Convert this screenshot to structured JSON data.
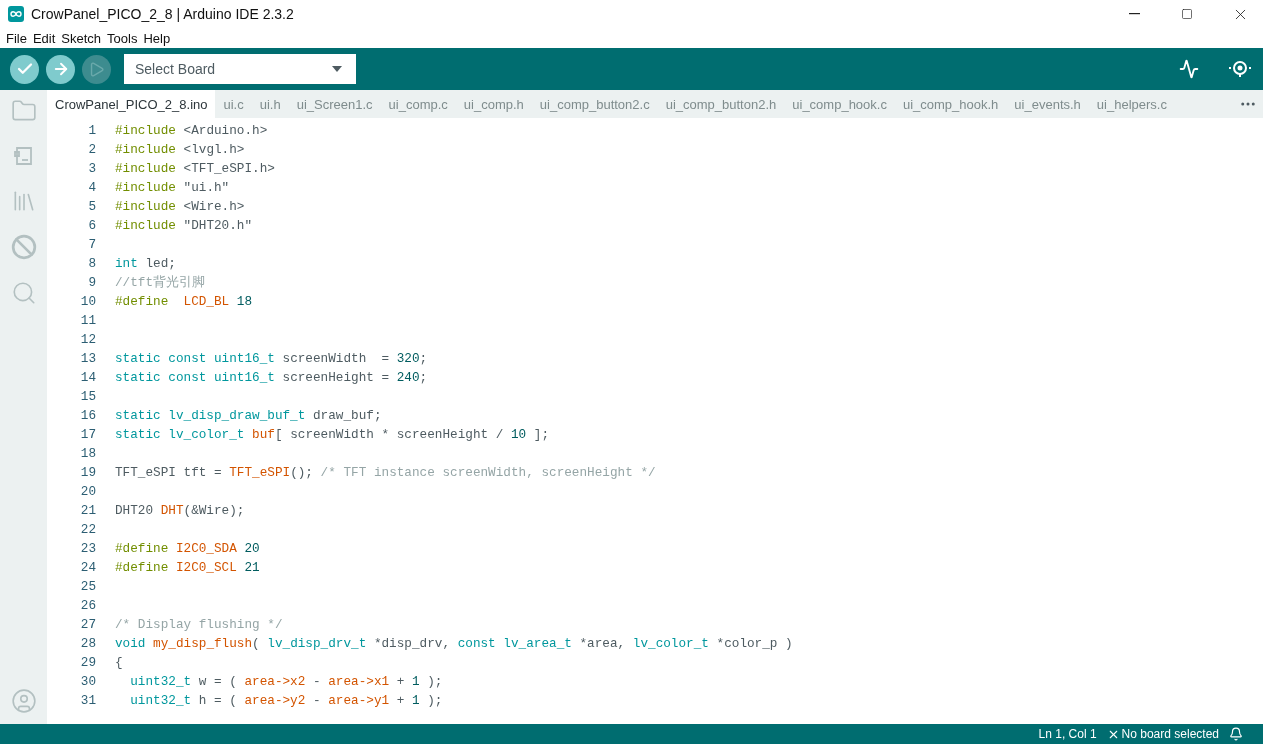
{
  "window": {
    "title": "CrowPanel_PICO_2_8 | Arduino IDE 2.3.2"
  },
  "menu": [
    "File",
    "Edit",
    "Sketch",
    "Tools",
    "Help"
  ],
  "toolbar": {
    "buttons": [
      {
        "kind": "verify",
        "disabled": false
      },
      {
        "kind": "upload",
        "disabled": false
      },
      {
        "kind": "debug",
        "disabled": true
      }
    ],
    "board_select": {
      "value": "Select Board"
    }
  },
  "tabs": [
    {
      "label": "CrowPanel_PICO_2_8.ino",
      "selected": true
    },
    {
      "label": "ui.c",
      "selected": false
    },
    {
      "label": "ui.h",
      "selected": false
    },
    {
      "label": "ui_Screen1.c",
      "selected": false
    },
    {
      "label": "ui_comp.c",
      "selected": false
    },
    {
      "label": "ui_comp.h",
      "selected": false
    },
    {
      "label": "ui_comp_button2.c",
      "selected": false
    },
    {
      "label": "ui_comp_button2.h",
      "selected": false
    },
    {
      "label": "ui_comp_hook.c",
      "selected": false
    },
    {
      "label": "ui_comp_hook.h",
      "selected": false
    },
    {
      "label": "ui_events.h",
      "selected": false
    },
    {
      "label": "ui_helpers.c",
      "selected": false
    }
  ],
  "sidebar": {
    "items": [
      {
        "kind": "folder"
      },
      {
        "kind": "boards"
      },
      {
        "kind": "library"
      },
      {
        "kind": "debug"
      },
      {
        "kind": "search"
      }
    ],
    "bottom": [
      {
        "kind": "account"
      }
    ]
  },
  "editor": {
    "lines": [
      {
        "number": "1",
        "tokens": [
          {
            "kind": "pre",
            "text": "#include"
          },
          {
            "kind": "plain",
            "text": " <Arduino.h>"
          }
        ]
      },
      {
        "number": "2",
        "tokens": [
          {
            "kind": "pre",
            "text": "#include"
          },
          {
            "kind": "plain",
            "text": " <lvgl.h>"
          }
        ]
      },
      {
        "number": "3",
        "tokens": [
          {
            "kind": "pre",
            "text": "#include"
          },
          {
            "kind": "plain",
            "text": " <TFT_eSPI.h>"
          }
        ]
      },
      {
        "number": "4",
        "tokens": [
          {
            "kind": "pre",
            "text": "#include"
          },
          {
            "kind": "plain",
            "text": " \"ui.h\""
          }
        ]
      },
      {
        "number": "5",
        "tokens": [
          {
            "kind": "pre",
            "text": "#include"
          },
          {
            "kind": "plain",
            "text": " <Wire.h>"
          }
        ]
      },
      {
        "number": "6",
        "tokens": [
          {
            "kind": "pre",
            "text": "#include"
          },
          {
            "kind": "plain",
            "text": " \"DHT20.h\""
          }
        ]
      },
      {
        "number": "7"
      },
      {
        "number": "8",
        "tokens": [
          {
            "kind": "type",
            "text": "int"
          },
          {
            "kind": "plain",
            "text": " led;"
          }
        ]
      },
      {
        "number": "9",
        "tokens": [
          {
            "kind": "comment",
            "text": "//tft背光引脚"
          }
        ]
      },
      {
        "number": "10",
        "tokens": [
          {
            "kind": "pre",
            "text": "#define"
          },
          {
            "kind": "fn",
            "text": "  LCD_BL"
          },
          {
            "kind": "num",
            "text": " 18"
          }
        ]
      },
      {
        "number": "11"
      },
      {
        "number": "12"
      },
      {
        "number": "13",
        "tokens": [
          {
            "kind": "type",
            "text": "static"
          },
          {
            "kind": "type",
            "text": " const"
          },
          {
            "kind": "type",
            "text": " uint16_t"
          },
          {
            "kind": "plain",
            "text": " screenWidth  = "
          },
          {
            "kind": "num",
            "text": "320"
          },
          {
            "kind": "plain",
            "text": ";"
          }
        ]
      },
      {
        "number": "14",
        "tokens": [
          {
            "kind": "type",
            "text": "static"
          },
          {
            "kind": "type",
            "text": " const"
          },
          {
            "kind": "type",
            "text": " uint16_t"
          },
          {
            "kind": "plain",
            "text": " screenHeight = "
          },
          {
            "kind": "num",
            "text": "240"
          },
          {
            "kind": "plain",
            "text": ";"
          }
        ]
      },
      {
        "number": "15"
      },
      {
        "number": "16",
        "tokens": [
          {
            "kind": "type",
            "text": "static"
          },
          {
            "kind": "type",
            "text": " lv_disp_draw_buf_t"
          },
          {
            "kind": "plain",
            "text": " draw_buf;"
          }
        ]
      },
      {
        "number": "17",
        "tokens": [
          {
            "kind": "type",
            "text": "static"
          },
          {
            "kind": "type",
            "text": " lv_color_t"
          },
          {
            "kind": "fn",
            "text": " buf"
          },
          {
            "kind": "plain",
            "text": "[ screenWidth * screenHeight / "
          },
          {
            "kind": "num",
            "text": "10"
          },
          {
            "kind": "plain",
            "text": " ];"
          }
        ]
      },
      {
        "number": "18"
      },
      {
        "number": "19",
        "tokens": [
          {
            "kind": "plain",
            "text": "TFT_eSPI tft = "
          },
          {
            "kind": "fn",
            "text": "TFT_eSPI"
          },
          {
            "kind": "plain",
            "text": "(); "
          },
          {
            "kind": "comment",
            "text": "/* TFT instance screenWidth, screenHeight */"
          }
        ]
      },
      {
        "number": "20"
      },
      {
        "number": "21",
        "tokens": [
          {
            "kind": "plain",
            "text": "DHT20 "
          },
          {
            "kind": "fn",
            "text": "DHT"
          },
          {
            "kind": "plain",
            "text": "(&Wire);"
          }
        ]
      },
      {
        "number": "22"
      },
      {
        "number": "23",
        "tokens": [
          {
            "kind": "pre",
            "text": "#define"
          },
          {
            "kind": "fn",
            "text": " I2C0_SDA"
          },
          {
            "kind": "num",
            "text": " 20"
          }
        ]
      },
      {
        "number": "24",
        "tokens": [
          {
            "kind": "pre",
            "text": "#define"
          },
          {
            "kind": "fn",
            "text": " I2C0_SCL"
          },
          {
            "kind": "num",
            "text": " 21"
          }
        ]
      },
      {
        "number": "25"
      },
      {
        "number": "26"
      },
      {
        "number": "27",
        "tokens": [
          {
            "kind": "comment",
            "text": "/* Display flushing */"
          }
        ]
      },
      {
        "number": "28",
        "tokens": [
          {
            "kind": "type",
            "text": "void"
          },
          {
            "kind": "fn",
            "text": " my_disp_flush"
          },
          {
            "kind": "plain",
            "text": "( "
          },
          {
            "kind": "type",
            "text": "lv_disp_drv_t"
          },
          {
            "kind": "plain",
            "text": " *disp_drv, "
          },
          {
            "kind": "type",
            "text": "const"
          },
          {
            "kind": "type",
            "text": " lv_area_t"
          },
          {
            "kind": "plain",
            "text": " *area, "
          },
          {
            "kind": "type",
            "text": "lv_color_t"
          },
          {
            "kind": "plain",
            "text": " *color_p )"
          }
        ]
      },
      {
        "number": "29",
        "tokens": [
          {
            "kind": "plain",
            "text": "{"
          }
        ]
      },
      {
        "number": "30",
        "tokens": [
          {
            "kind": "type",
            "text": "  uint32_t"
          },
          {
            "kind": "plain",
            "text": " w = ( "
          },
          {
            "kind": "fn",
            "text": "area->x2"
          },
          {
            "kind": "plain",
            "text": " - "
          },
          {
            "kind": "fn",
            "text": "area->x1"
          },
          {
            "kind": "plain",
            "text": " + "
          },
          {
            "kind": "num",
            "text": "1"
          },
          {
            "kind": "plain",
            "text": " );"
          }
        ]
      },
      {
        "number": "31",
        "tokens": [
          {
            "kind": "type",
            "text": "  uint32_t"
          },
          {
            "kind": "plain",
            "text": " h = ( "
          },
          {
            "kind": "fn",
            "text": "area->y2"
          },
          {
            "kind": "plain",
            "text": " - "
          },
          {
            "kind": "fn",
            "text": "area->y1"
          },
          {
            "kind": "plain",
            "text": " + "
          },
          {
            "kind": "num",
            "text": "1"
          },
          {
            "kind": "plain",
            "text": " );"
          }
        ]
      }
    ]
  },
  "status_bar": {
    "position": "Ln 1, Col 1",
    "board": "No board selected"
  }
}
